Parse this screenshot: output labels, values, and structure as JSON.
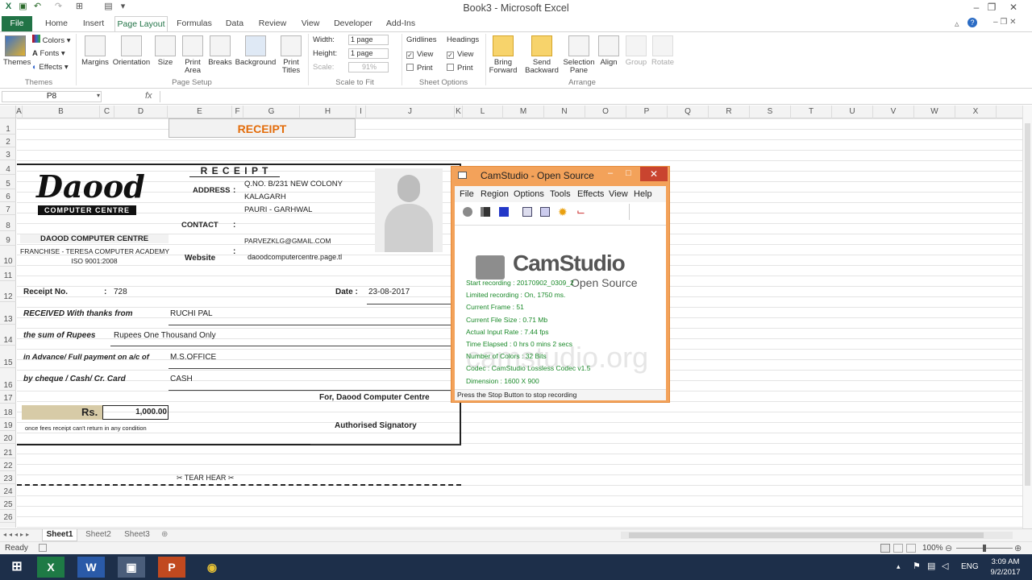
{
  "window": {
    "title": "Book3 - Microsoft Excel"
  },
  "tabs": [
    "File",
    "Home",
    "Insert",
    "Page Layout",
    "Formulas",
    "Data",
    "Review",
    "View",
    "Developer",
    "Add-Ins"
  ],
  "ribbon": {
    "themes": {
      "big": "Themes",
      "colors": "Colors",
      "fonts": "Fonts",
      "effects": "Effects",
      "group": "Themes"
    },
    "page_setup": {
      "margins": "Margins",
      "orientation": "Orientation",
      "size": "Size",
      "print_area": "Print Area",
      "breaks": "Breaks",
      "background": "Background",
      "print_titles": "Print Titles",
      "group": "Page Setup"
    },
    "scale": {
      "width_label": "Width:",
      "width_val": "1 page",
      "height_label": "Height:",
      "height_val": "1 page",
      "scale_label": "Scale:",
      "scale_val": "91%",
      "group": "Scale to Fit"
    },
    "sheet_opts": {
      "gridlines": "Gridlines",
      "headings": "Headings",
      "view": "View",
      "print": "Print",
      "group": "Sheet Options"
    },
    "arrange": {
      "bring_forward": "Bring Forward",
      "send_backward": "Send Backward",
      "selection_pane": "Selection Pane",
      "align": "Align",
      "group_btn": "Group",
      "rotate": "Rotate",
      "group": "Arrange"
    }
  },
  "formula_bar": {
    "name_box": "P8",
    "fx": "fx",
    "value": ""
  },
  "columns": [
    "A",
    "B",
    "C",
    "D",
    "E",
    "F",
    "G",
    "H",
    "I",
    "J",
    "K",
    "L",
    "M",
    "N",
    "O",
    "P",
    "Q",
    "R",
    "S",
    "T",
    "U",
    "V",
    "W",
    "X"
  ],
  "rows": [
    "1",
    "2",
    "3",
    "4",
    "5",
    "6",
    "7",
    "8",
    "9",
    "10",
    "11",
    "12",
    "13",
    "14",
    "15",
    "16",
    "17",
    "18",
    "19",
    "20",
    "21",
    "22",
    "23",
    "24",
    "25",
    "26"
  ],
  "receipt": {
    "header": "RECEIPT",
    "title": "R E C E I P T",
    "logo_name": "Daood",
    "logo_sub": "COMPUTER CENTRE",
    "centre": "DAOOD COMPUTER CENTRE",
    "franchise": "FRANCHISE - TERESA COMPUTER ACADEMY",
    "iso": "ISO 9001:2008",
    "address_label": "ADDRESS",
    "address1": "Q.NO. B/231 NEW COLONY",
    "address2": "KALAGARH",
    "address3": "PAURI - GARHWAL",
    "contact_label": "CONTACT",
    "email": "PARVEZKLG@GMAIL.COM",
    "website_label": "Website",
    "website": "daoodcomputercentre.page.tl",
    "colon": ":",
    "receipt_no_label": "Receipt No.",
    "receipt_no": "728",
    "date_label": "Date :",
    "date": "23-08-2017",
    "received_label": "RECEIVED With thanks from",
    "received": "RUCHI PAL",
    "sum_label": "the sum of Rupees",
    "sum": "Rupees One Thousand Only",
    "advance_label": "in Advance/ Full payment on a/c of",
    "advance": "M.S.OFFICE",
    "cheque_label": "by cheque / Cash/ Cr. Card",
    "cheque": "CASH",
    "for_label": "For, Daood Computer Centre",
    "rs_label": "Rs.",
    "amount": "1,000.00",
    "note": "once fees receipt can't return in any condition",
    "signatory": "Authorised Signatory",
    "tear": "✂ TEAR HEAR ✂"
  },
  "sheets": [
    "Sheet1",
    "Sheet2",
    "Sheet3"
  ],
  "status": {
    "ready": "Ready",
    "zoom": "100%"
  },
  "camstudio": {
    "title": "CamStudio - Open Source",
    "menu": [
      "File",
      "Region",
      "Options",
      "Tools",
      "Effects",
      "View",
      "Help"
    ],
    "logo_big": "CamStudio",
    "logo_small": "Open Source",
    "watermark": "camstudio.org",
    "lines": [
      "Start recording : 20170902_0309_2",
      "Limited recording : On, 1750 ms.",
      "Current Frame : 51",
      "Current File Size : 0.71 Mb",
      "Actual Input Rate : 7.44 fps",
      "Time Elapsed : 0 hrs 0 mins 2 secs",
      "Number of Colors : 32 Bits",
      "Codec : CamStudio Lossless Codec v1.5",
      "Dimension : 1600 X 900"
    ],
    "status": "Press the Stop Button to stop recording"
  },
  "taskbar": {
    "lang": "ENG",
    "time": "3:09 AM",
    "date": "9/2/2017"
  }
}
